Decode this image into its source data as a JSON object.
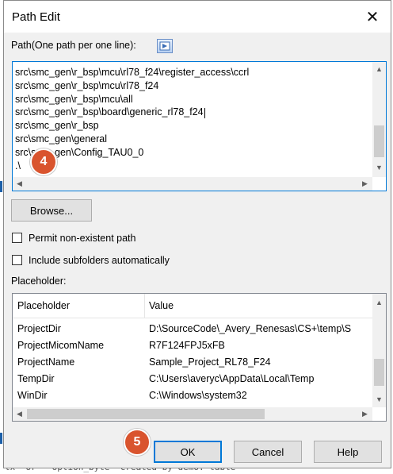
{
  "dialog": {
    "title": "Path Edit",
    "close_glyph": "✕"
  },
  "path": {
    "label": "Path(One path per one line):",
    "lines": [
      "src\\smc_gen\\r_bsp\\mcu\\rl78_f24\\register_access\\ccrl",
      "src\\smc_gen\\r_bsp\\mcu\\rl78_f24",
      "src\\smc_gen\\r_bsp\\mcu\\all",
      "src\\smc_gen\\r_bsp\\board\\generic_rl78_f24",
      "src\\smc_gen\\r_bsp",
      "src\\smc_gen\\general",
      "src\\smc_gen\\Config_TAU0_0",
      ".\\"
    ]
  },
  "browse_label": "Browse...",
  "options": {
    "permit_label": "Permit non-existent path",
    "subfolders_label": "Include subfolders automatically"
  },
  "placeholder": {
    "label": "Placeholder:",
    "columns": [
      "Placeholder",
      "Value"
    ],
    "rows": [
      {
        "name": "ProjectDir",
        "value": "D:\\SourceCode\\_Avery_Renesas\\CS+\\temp\\S"
      },
      {
        "name": "ProjectMicomName",
        "value": "R7F124FPJ5xFB"
      },
      {
        "name": "ProjectName",
        "value": "Sample_Project_RL78_F24"
      },
      {
        "name": "TempDir",
        "value": "C:\\Users\\averyc\\AppData\\Local\\Temp"
      },
      {
        "name": "WinDir",
        "value": "C:\\Windows\\system32"
      }
    ]
  },
  "buttons": {
    "ok": "OK",
    "cancel": "Cancel",
    "help": "Help"
  },
  "badges": {
    "step4": "4",
    "step5": "5"
  },
  "background": {
    "bottom_text": "tx\" or \" option_byte\" created by demo: table"
  },
  "colors": {
    "focus_border": "#0078d7",
    "badge": "#d9542e",
    "dialog_bg": "#f0f0f0"
  }
}
